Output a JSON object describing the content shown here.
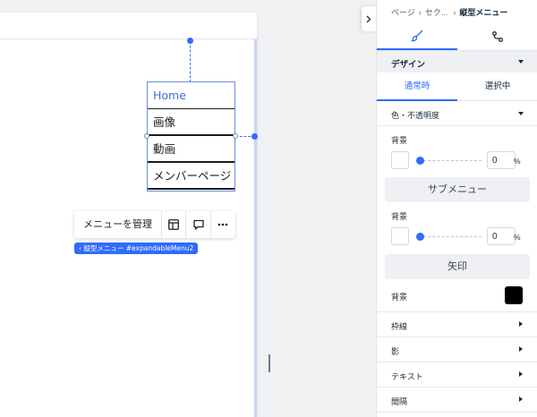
{
  "canvas": {
    "menu_items": [
      {
        "label": "Home",
        "active": true
      },
      {
        "label": "画像"
      },
      {
        "label": "動画"
      },
      {
        "label": "メンバーページ"
      }
    ],
    "context_bar": {
      "manage_label": "メニューを管理",
      "layout_icon": "layout-icon",
      "comment_icon": "comment-icon",
      "more_icon": "more-icon"
    },
    "element_tag": "‹ 縦型メニュー #expandableMenu2"
  },
  "panel": {
    "breadcrumb": {
      "items": [
        "ページ",
        "セク..."
      ],
      "current": "縦型メニュー"
    },
    "top_tabs": [
      {
        "icon": "paintbrush-icon",
        "selected": true
      },
      {
        "icon": "connect-icon"
      }
    ],
    "design_section": "デザイン",
    "state_tabs": [
      {
        "label": "通常時",
        "selected": true
      },
      {
        "label": "選択中"
      }
    ],
    "color_opacity": "色・不透明度",
    "background_label": "背景",
    "bg_opacity": "0",
    "pct_symbol": "%",
    "submenu_heading": "サブメニュー",
    "submenu_background_label": "背景",
    "submenu_opacity": "0",
    "arrow_heading": "矢印",
    "arrow_background_label": "背景",
    "arrow_color": "#000000",
    "expanders": [
      "枠線",
      "影",
      "テキスト",
      "間隔"
    ]
  },
  "colors": {
    "accent": "#2f6bff",
    "active_menu_text": "#3d6fdc"
  }
}
